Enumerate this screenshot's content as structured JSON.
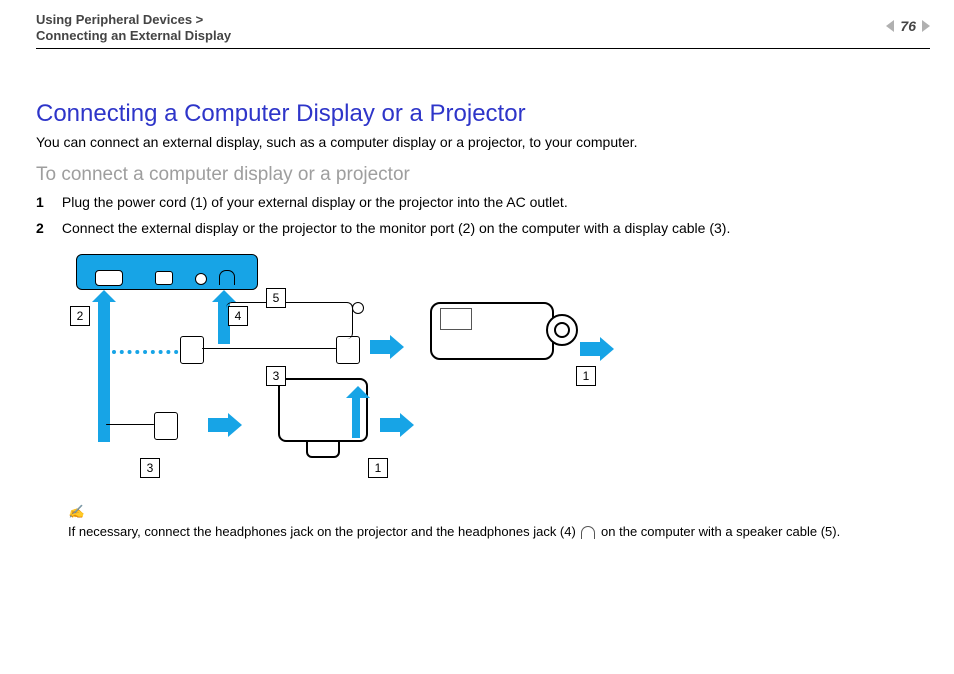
{
  "header": {
    "breadcrumb_parent": "Using Peripheral Devices >",
    "breadcrumb_child": "Connecting an External Display",
    "page_number": "76"
  },
  "main": {
    "title": "Connecting a Computer Display or a Projector",
    "intro": "You can connect an external display, such as a computer display or a projector, to your computer.",
    "subtitle": "To connect a computer display or a projector",
    "steps": [
      {
        "num": "1",
        "text": "Plug the power cord (1) of your external display or the projector into the AC outlet."
      },
      {
        "num": "2",
        "text": "Connect the external display or the projector to the monitor port (2) on the computer with a display cable (3)."
      }
    ],
    "note_prefix": "If necessary, connect the headphones jack on the projector and the headphones jack (4) ",
    "note_suffix": " on the computer with a speaker cable (5).",
    "note_icon": "✍"
  },
  "diagram": {
    "callouts": {
      "c1": "1",
      "c2": "2",
      "c3": "3",
      "c4": "4",
      "c5": "5"
    }
  }
}
